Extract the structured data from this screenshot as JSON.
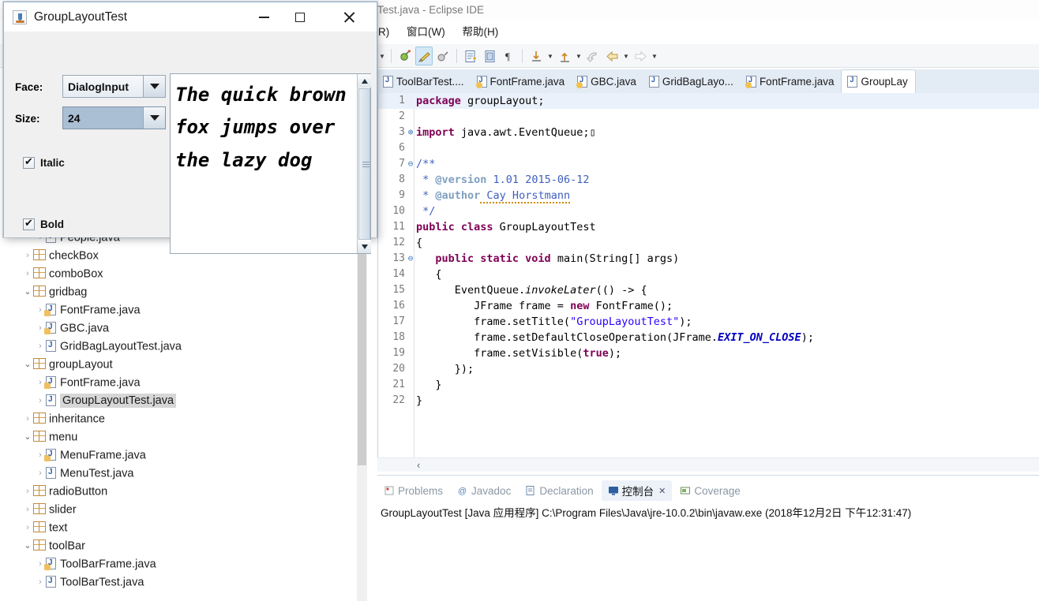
{
  "eclipse": {
    "title": "Test.java - Eclipse IDE",
    "menu": [
      "R)",
      "窗口(W)",
      "帮助(H)"
    ],
    "toolbar_icons": [
      "dropdown-arrow",
      "debug-icon",
      "run-icon",
      "run-external-icon",
      "new-java-project-icon",
      "open-type-icon",
      "paragraph-icon",
      "step-into-icon",
      "dropdown-arrow",
      "step-return-icon",
      "dropdown-arrow",
      "back-icon",
      "back-arrow-icon",
      "dropdown-arrow",
      "forward-arrow-icon",
      "dropdown-arrow"
    ],
    "editor_tabs": [
      {
        "label": "ToolBarTest....",
        "active": false,
        "warn": false
      },
      {
        "label": "FontFrame.java",
        "active": false,
        "warn": true
      },
      {
        "label": "GBC.java",
        "active": false,
        "warn": true
      },
      {
        "label": "GridBagLayo...",
        "active": false,
        "warn": false
      },
      {
        "label": "FontFrame.java",
        "active": false,
        "warn": true
      },
      {
        "label": "GroupLay",
        "active": true,
        "warn": false
      }
    ]
  },
  "code": {
    "lines": [
      {
        "n": "1",
        "fold": "",
        "current": true,
        "parts": [
          {
            "t": "package ",
            "c": "kw"
          },
          {
            "t": "groupLayout;",
            "c": "plain"
          }
        ]
      },
      {
        "n": "2",
        "fold": "",
        "parts": []
      },
      {
        "n": "3",
        "fold": "⊕",
        "parts": [
          {
            "t": "import ",
            "c": "kw"
          },
          {
            "t": "java.awt.EventQueue;",
            "c": "plain"
          },
          {
            "t": "▯",
            "c": "plain"
          }
        ]
      },
      {
        "n": "6",
        "fold": "",
        "parts": []
      },
      {
        "n": "7",
        "fold": "⊖",
        "parts": [
          {
            "t": "/**",
            "c": "jdoc"
          }
        ]
      },
      {
        "n": "8",
        "fold": "",
        "parts": [
          {
            "t": " * ",
            "c": "jdoc"
          },
          {
            "t": "@version",
            "c": "jtag"
          },
          {
            "t": " 1.01 2015-06-12",
            "c": "jdoc"
          }
        ]
      },
      {
        "n": "9",
        "fold": "",
        "parts": [
          {
            "t": " * ",
            "c": "jdoc"
          },
          {
            "t": "@author",
            "c": "jtag"
          },
          {
            "t": " Cay Horstmann",
            "c": "jdoc sqz"
          }
        ]
      },
      {
        "n": "10",
        "fold": "",
        "parts": [
          {
            "t": " */",
            "c": "jdoc"
          }
        ]
      },
      {
        "n": "11",
        "fold": "",
        "parts": [
          {
            "t": "public class ",
            "c": "kw"
          },
          {
            "t": "GroupLayoutTest",
            "c": "plain"
          }
        ]
      },
      {
        "n": "12",
        "fold": "",
        "parts": [
          {
            "t": "{",
            "c": "plain"
          }
        ]
      },
      {
        "n": "13",
        "fold": "⊖",
        "parts": [
          {
            "t": "   ",
            "c": "plain"
          },
          {
            "t": "public static void ",
            "c": "kw"
          },
          {
            "t": "main(String[] args)",
            "c": "plain"
          }
        ]
      },
      {
        "n": "14",
        "fold": "",
        "parts": [
          {
            "t": "   {",
            "c": "plain"
          }
        ]
      },
      {
        "n": "15",
        "fold": "",
        "parts": [
          {
            "t": "      EventQueue.",
            "c": "plain"
          },
          {
            "t": "invokeLater",
            "c": "stat"
          },
          {
            "t": "(() -> {",
            "c": "plain"
          }
        ]
      },
      {
        "n": "16",
        "fold": "",
        "parts": [
          {
            "t": "         JFrame frame = ",
            "c": "plain"
          },
          {
            "t": "new ",
            "c": "kw"
          },
          {
            "t": "FontFrame();",
            "c": "plain"
          }
        ]
      },
      {
        "n": "17",
        "fold": "",
        "parts": [
          {
            "t": "         frame.setTitle(",
            "c": "plain"
          },
          {
            "t": "\"GroupLayoutTest\"",
            "c": "str"
          },
          {
            "t": ");",
            "c": "plain"
          }
        ]
      },
      {
        "n": "18",
        "fold": "",
        "parts": [
          {
            "t": "         frame.setDefaultCloseOperation(JFrame.",
            "c": "plain"
          },
          {
            "t": "EXIT_ON_CLOSE",
            "c": "statb"
          },
          {
            "t": ");",
            "c": "plain"
          }
        ]
      },
      {
        "n": "19",
        "fold": "",
        "parts": [
          {
            "t": "         frame.setVisible(",
            "c": "plain"
          },
          {
            "t": "true",
            "c": "kw"
          },
          {
            "t": ");",
            "c": "plain"
          }
        ]
      },
      {
        "n": "20",
        "fold": "",
        "parts": [
          {
            "t": "      });",
            "c": "plain"
          }
        ]
      },
      {
        "n": "21",
        "fold": "",
        "parts": [
          {
            "t": "   }",
            "c": "plain"
          }
        ]
      },
      {
        "n": "22",
        "fold": "",
        "parts": [
          {
            "t": "}",
            "c": "plain"
          }
        ]
      }
    ]
  },
  "console": {
    "tabs": [
      {
        "label": "Problems",
        "icon": "problems-icon",
        "active": false
      },
      {
        "label": "Javadoc",
        "icon": "javadoc-icon",
        "active": false
      },
      {
        "label": "Declaration",
        "icon": "declaration-icon",
        "active": false
      },
      {
        "label": "控制台",
        "icon": "console-icon",
        "active": true,
        "close": "✕"
      },
      {
        "label": "Coverage",
        "icon": "coverage-icon",
        "active": false
      }
    ],
    "output_line": "GroupLayoutTest [Java 应用程序] C:\\Program Files\\Java\\jre-10.0.2\\bin\\javaw.exe  (2018年12月2日 下午12:31:47)"
  },
  "explorer": {
    "items": [
      {
        "label": "People.java",
        "indent": 3,
        "type": "java",
        "arrow": "closed",
        "warn": false,
        "selected": false
      },
      {
        "label": "checkBox",
        "indent": 2,
        "type": "pkg",
        "arrow": "closed",
        "selected": false
      },
      {
        "label": "comboBox",
        "indent": 2,
        "type": "pkg",
        "arrow": "closed",
        "selected": false
      },
      {
        "label": "gridbag",
        "indent": 2,
        "type": "pkg",
        "arrow": "open",
        "selected": false
      },
      {
        "label": "FontFrame.java",
        "indent": 3,
        "type": "java",
        "arrow": "closed",
        "warn": true,
        "selected": false
      },
      {
        "label": "GBC.java",
        "indent": 3,
        "type": "java",
        "arrow": "closed",
        "warn": true,
        "selected": false
      },
      {
        "label": "GridBagLayoutTest.java",
        "indent": 3,
        "type": "java",
        "arrow": "closed",
        "warn": false,
        "selected": false
      },
      {
        "label": "groupLayout",
        "indent": 2,
        "type": "pkg",
        "arrow": "open",
        "selected": false
      },
      {
        "label": "FontFrame.java",
        "indent": 3,
        "type": "java",
        "arrow": "closed",
        "warn": true,
        "selected": false
      },
      {
        "label": "GroupLayoutTest.java",
        "indent": 3,
        "type": "java",
        "arrow": "closed",
        "warn": false,
        "selected": true
      },
      {
        "label": "inheritance",
        "indent": 2,
        "type": "pkg",
        "arrow": "closed",
        "selected": false
      },
      {
        "label": "menu",
        "indent": 2,
        "type": "pkg",
        "arrow": "open",
        "selected": false
      },
      {
        "label": "MenuFrame.java",
        "indent": 3,
        "type": "java",
        "arrow": "closed",
        "warn": true,
        "selected": false
      },
      {
        "label": "MenuTest.java",
        "indent": 3,
        "type": "java",
        "arrow": "closed",
        "warn": false,
        "selected": false
      },
      {
        "label": "radioButton",
        "indent": 2,
        "type": "pkg",
        "arrow": "closed",
        "selected": false
      },
      {
        "label": "slider",
        "indent": 2,
        "type": "pkg",
        "arrow": "closed",
        "selected": false
      },
      {
        "label": "text",
        "indent": 2,
        "type": "pkg",
        "arrow": "closed",
        "selected": false
      },
      {
        "label": "toolBar",
        "indent": 2,
        "type": "pkg",
        "arrow": "open",
        "selected": false
      },
      {
        "label": "ToolBarFrame.java",
        "indent": 3,
        "type": "java",
        "arrow": "closed",
        "warn": true,
        "selected": false
      },
      {
        "label": "ToolBarTest.java",
        "indent": 3,
        "type": "java",
        "arrow": "closed",
        "warn": false,
        "selected": false
      }
    ]
  },
  "dialog": {
    "title": "GroupLayoutTest",
    "window_buttons": {
      "minimize": "minimize-button",
      "maximize": "maximize-button",
      "close": "close-button"
    },
    "face_label": "Face:",
    "face_value": "DialogInput",
    "size_label": "Size:",
    "size_value": "24",
    "italic_label": "Italic",
    "italic_checked": true,
    "bold_label": "Bold",
    "bold_checked": true,
    "sample_text": "The quick brown fox jumps over the lazy dog"
  }
}
